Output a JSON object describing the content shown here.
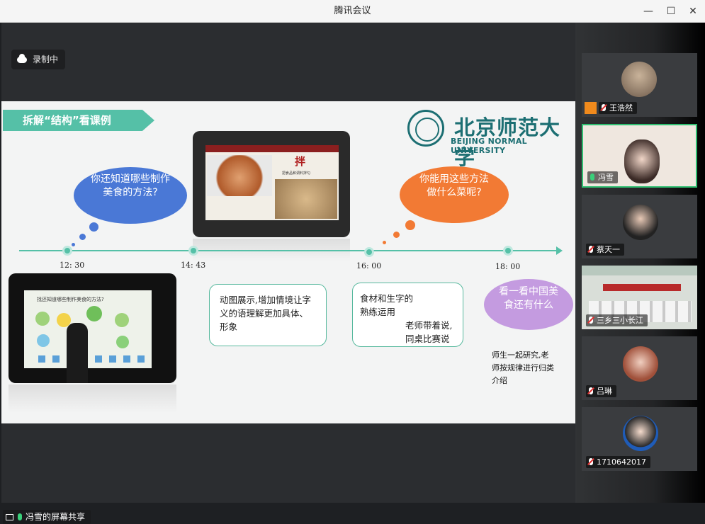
{
  "window": {
    "title": "腾讯会议",
    "min": "—",
    "max": "☐",
    "close": "✕"
  },
  "recording": {
    "label": "录制中",
    "icon": "cloud-icon"
  },
  "slide": {
    "ribbon": "拆解“结构”看课例",
    "logo": {
      "cn": "北京师范大学",
      "en": "BEIJING NORMAL UNIVERSITY"
    },
    "times": [
      "12: 30",
      "14: 43",
      "16: 00",
      "18: 00"
    ],
    "bubbles": {
      "blue": "你还知道哪些制作美食的方法?",
      "orange": "你能用这些方法做什么菜呢?",
      "purple": "看一看中国美食还有什么"
    },
    "notes": {
      "note1": "动图展示,增加情境让字义的语理解更加具体、形象",
      "note2a": "食材和生字的熟练运用",
      "note2b": "老师带着说,同桌比赛说"
    },
    "handwritten": "师生一起研究,老师按规律进行归类介绍",
    "photo_top": {
      "char": "拌",
      "caption": "把食品和调料拌匀"
    },
    "photo_left": {
      "caption": "找还知道哪些制作美食的方法?"
    }
  },
  "participants": [
    {
      "name": "王浩然",
      "mic": "muted",
      "host": true
    },
    {
      "name": "冯雪",
      "mic": "on",
      "active": true
    },
    {
      "name": "蔡天一",
      "mic": "muted"
    },
    {
      "name": "三乡三小长江",
      "mic": "muted"
    },
    {
      "name": "吕琳",
      "mic": "muted"
    },
    {
      "name": "1710642017",
      "mic": "muted"
    }
  ],
  "share": {
    "label": "冯雪的屏幕共享"
  }
}
